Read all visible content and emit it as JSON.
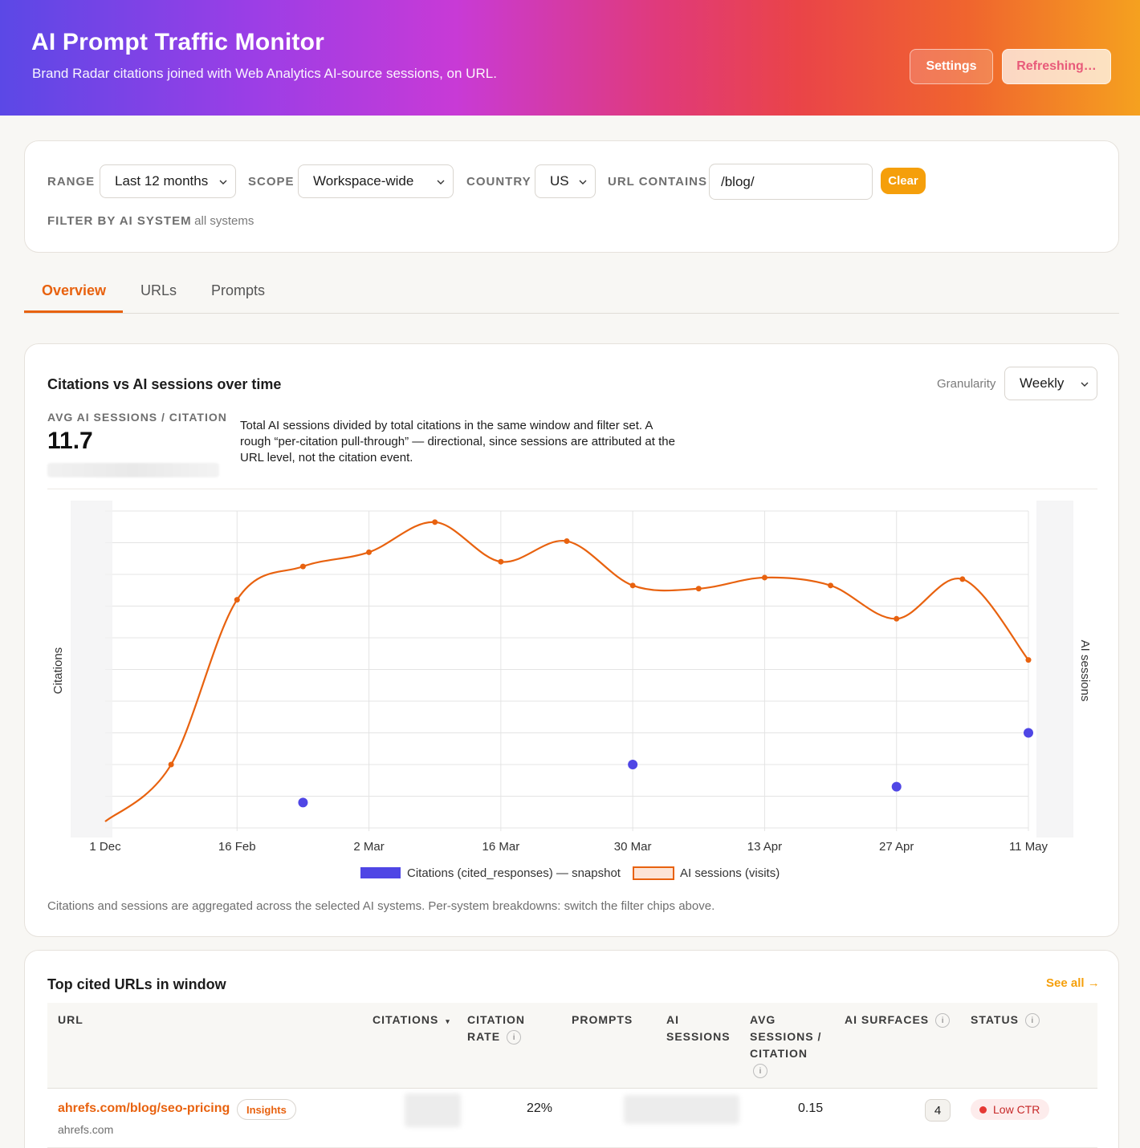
{
  "header": {
    "title": "AI Prompt Traffic Monitor",
    "subtitle": "Brand Radar citations joined with Web Analytics AI-source sessions, on URL.",
    "settings_label": "Settings",
    "refresh_label": "Refreshing…"
  },
  "filters": {
    "range_label": "RANGE",
    "range_value": "Last 12 months",
    "scope_label": "SCOPE",
    "scope_value": "Workspace-wide",
    "country_label": "COUNTRY",
    "country_value": "US",
    "url_label": "URL CONTAINS",
    "url_value": "/blog/",
    "clear_label": "Clear",
    "ai_system_label": "FILTER BY AI SYSTEM",
    "ai_system_note": "· all systems"
  },
  "tabs": [
    {
      "label": "Overview",
      "active": true
    },
    {
      "label": "URLs",
      "active": false
    },
    {
      "label": "Prompts",
      "active": false
    }
  ],
  "chart_card": {
    "title": "Citations vs AI sessions over time",
    "granularity_label": "Granularity",
    "granularity_value": "Weekly",
    "kpi_label": "AVG AI SESSIONS / CITATION",
    "kpi_value": "11.7",
    "kpi_description": "Total AI sessions divided by total citations in the same window and filter set. A rough “per-citation pull-through” — directional, since sessions are attributed at the URL level, not the citation event.",
    "footnote": "Citations and sessions are aggregated across the selected AI systems. Per-system breakdowns: switch the filter chips above."
  },
  "chart_data": {
    "type": "line",
    "x_ticks": [
      "1 Dec",
      "16 Feb",
      "2 Mar",
      "16 Mar",
      "30 Mar",
      "13 Apr",
      "27 Apr",
      "11 May"
    ],
    "ylabel_left": "Citations",
    "ylabel_right": "AI sessions",
    "grid": true,
    "legend_position": "bottom",
    "colors": {
      "citations": "#4f46e5",
      "sessions": "#e8620f"
    },
    "series": [
      {
        "name": "Citations (cited_responses) — snapshot",
        "axis": "left",
        "points": [
          {
            "x": 1.5,
            "y": 0.8
          },
          {
            "x": 4,
            "y": 2.0
          },
          {
            "x": 6,
            "y": 1.3
          },
          {
            "x": 7,
            "y": 3.0
          }
        ]
      },
      {
        "name": "AI sessions (visits)",
        "axis": "right",
        "points": [
          {
            "x": 0,
            "y": 0.2
          },
          {
            "x": 0.5,
            "y": 2.0
          },
          {
            "x": 1,
            "y": 7.2
          },
          {
            "x": 1.5,
            "y": 8.25
          },
          {
            "x": 2,
            "y": 8.7
          },
          {
            "x": 2.5,
            "y": 9.65
          },
          {
            "x": 3,
            "y": 8.4
          },
          {
            "x": 3.5,
            "y": 9.05
          },
          {
            "x": 4,
            "y": 7.65
          },
          {
            "x": 4.5,
            "y": 7.55
          },
          {
            "x": 5,
            "y": 7.9
          },
          {
            "x": 5.5,
            "y": 7.65
          },
          {
            "x": 6,
            "y": 6.6
          },
          {
            "x": 6.5,
            "y": 7.85
          },
          {
            "x": 7,
            "y": 5.3
          }
        ]
      }
    ],
    "xlim": [
      0,
      7
    ],
    "ylim_left": [
      0,
      10
    ],
    "ylim_right": [
      0,
      10
    ]
  },
  "table": {
    "title": "Top cited URLs in window",
    "see_all": "See all →",
    "columns": {
      "url": "URL",
      "citations": "CITATIONS",
      "citation_rate_1": "CITATION",
      "citation_rate_2": "RATE",
      "prompts": "PROMPTS",
      "ai_sessions_1": "AI",
      "ai_sessions_2": "SESSIONS",
      "avg_1": "AVG",
      "avg_2": "SESSIONS /",
      "avg_3": "CITATION",
      "ai_surfaces": "AI SURFACES",
      "status": "STATUS",
      "info_glyph": "i",
      "sort_glyph": "▾"
    },
    "rows": [
      {
        "url": "ahrefs.com/blog/seo-pricing",
        "badge": "Insights",
        "domain": "ahrefs.com",
        "citation_rate": "22%",
        "avg_sessions_per_citation": "0.15",
        "ai_surfaces": "4",
        "status": "Low CTR"
      }
    ]
  }
}
